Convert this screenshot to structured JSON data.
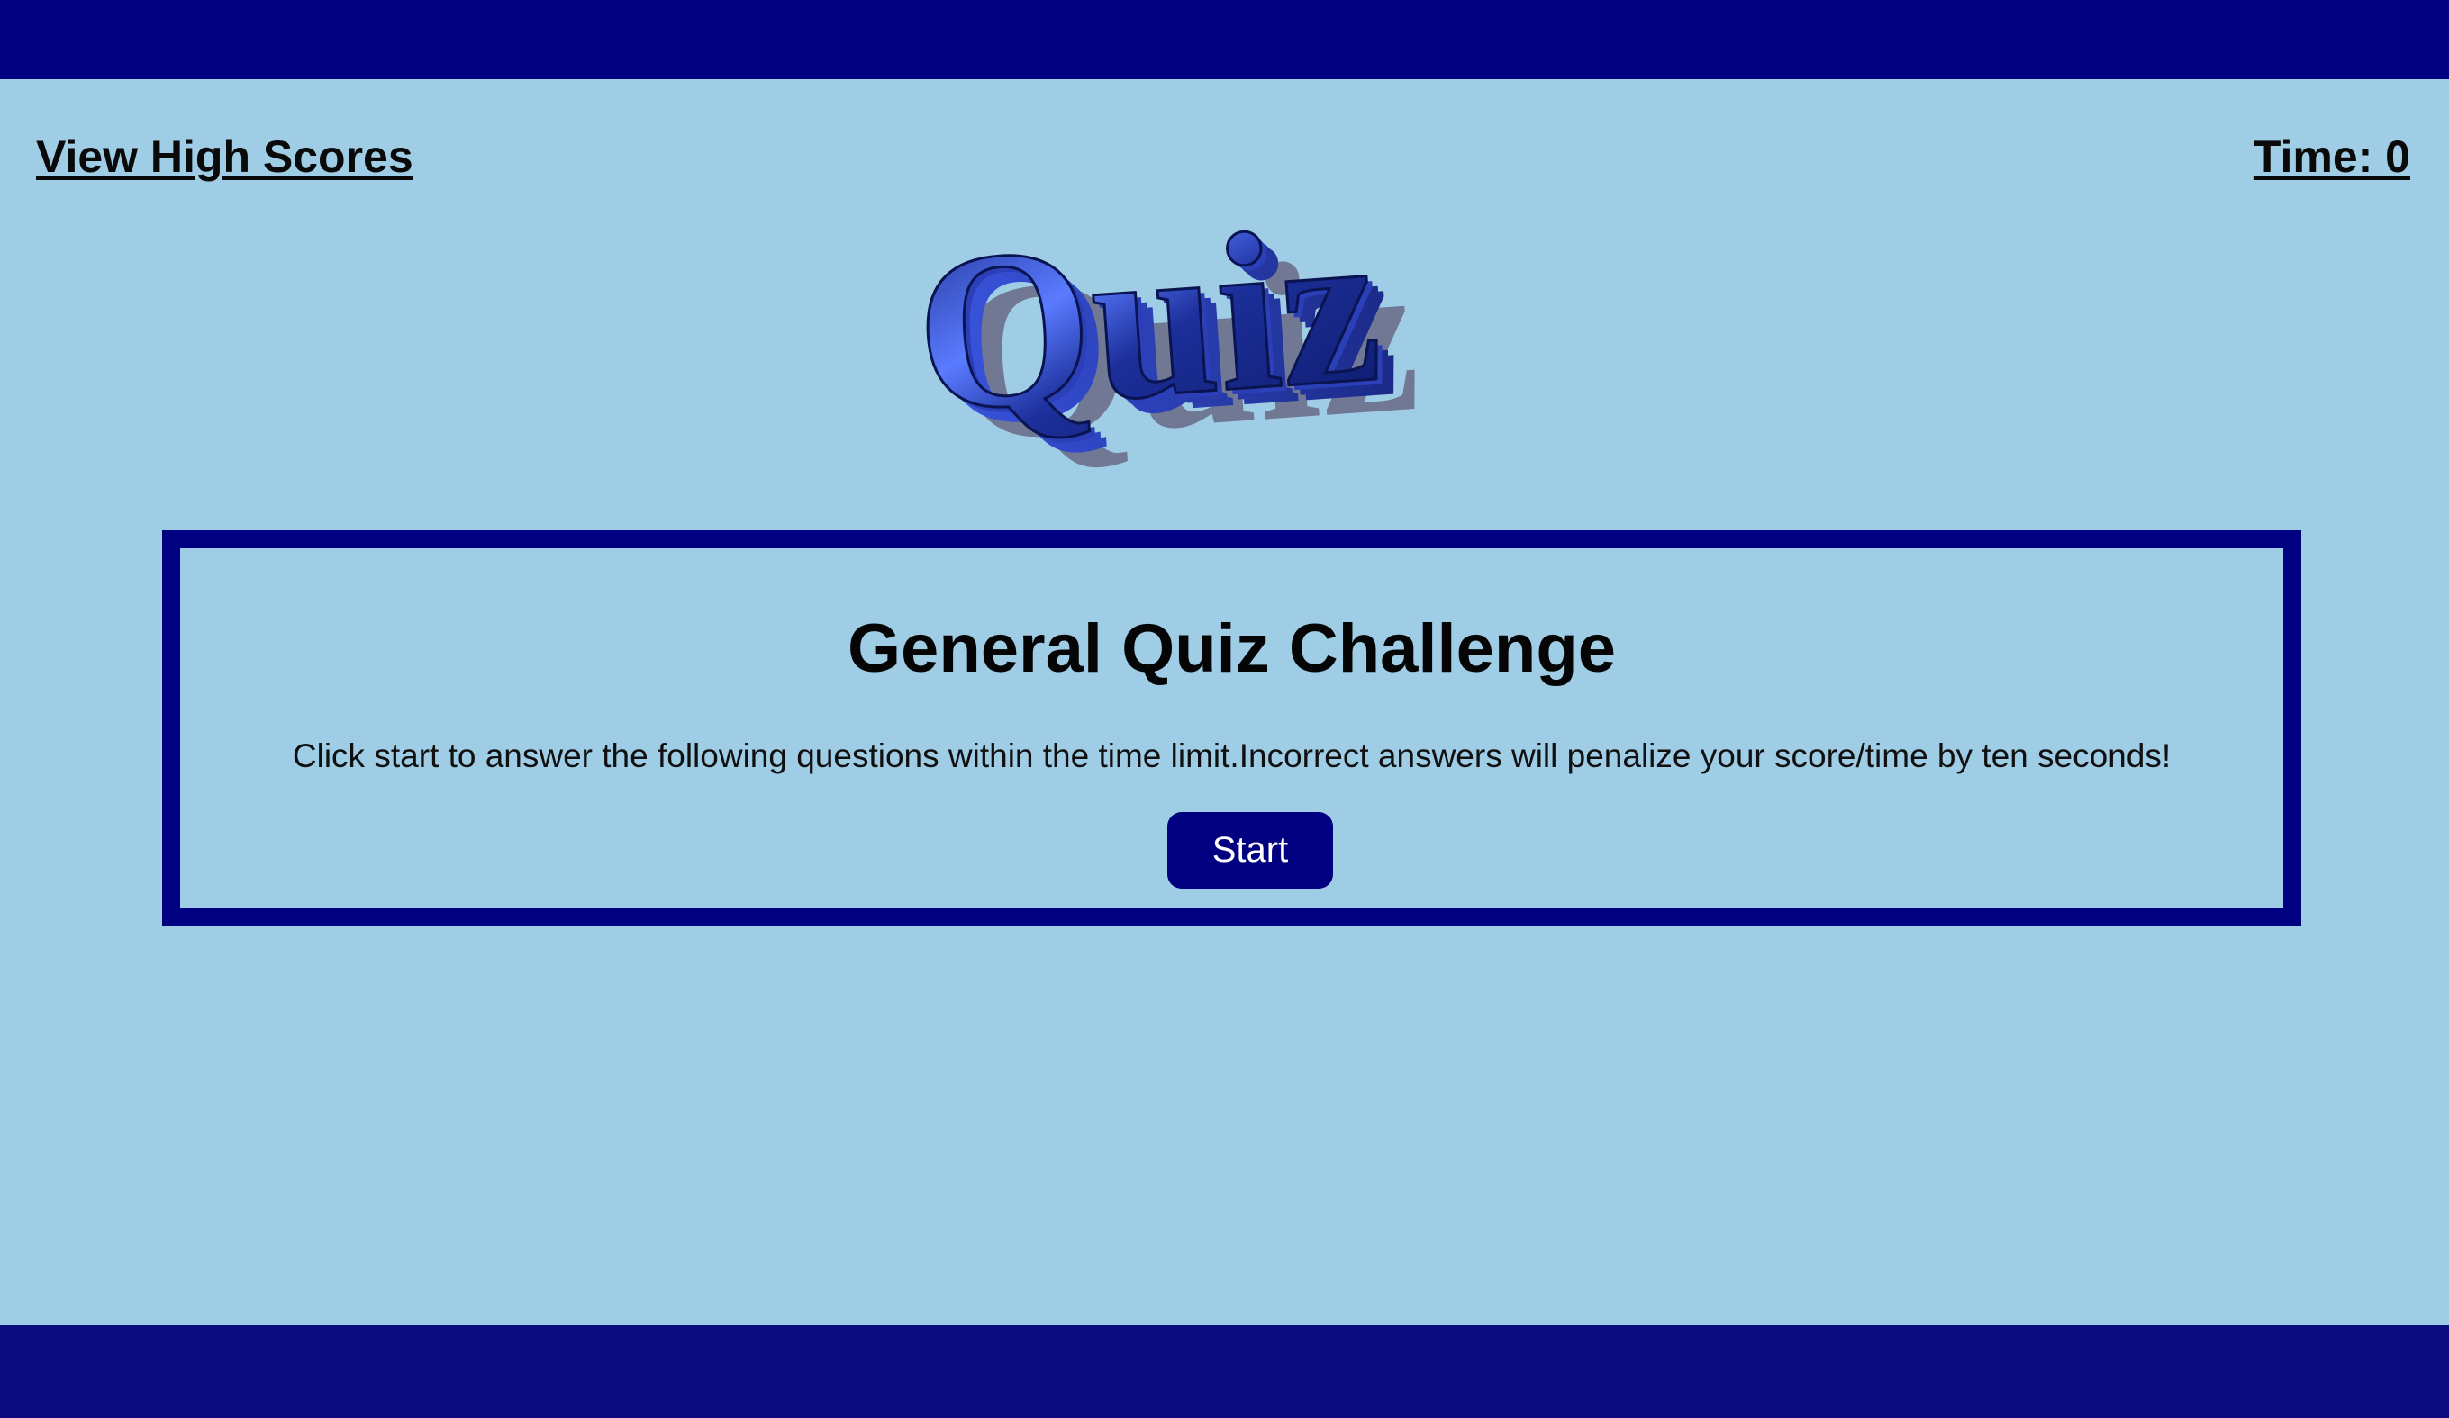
{
  "header": {
    "high_scores_label": "View High Scores",
    "timer_text": "Time: 0"
  },
  "logo": {
    "text": "Quiz",
    "icon": "3d-quiz-logo"
  },
  "card": {
    "title": "General Quiz Challenge",
    "description": "Click start to answer the following questions within the time limit.Incorrect answers will penalize your score/time by ten seconds!",
    "start_label": "Start"
  },
  "colors": {
    "background": "#a0cde6",
    "accent": "#000080",
    "footer": "#0c0c80"
  }
}
